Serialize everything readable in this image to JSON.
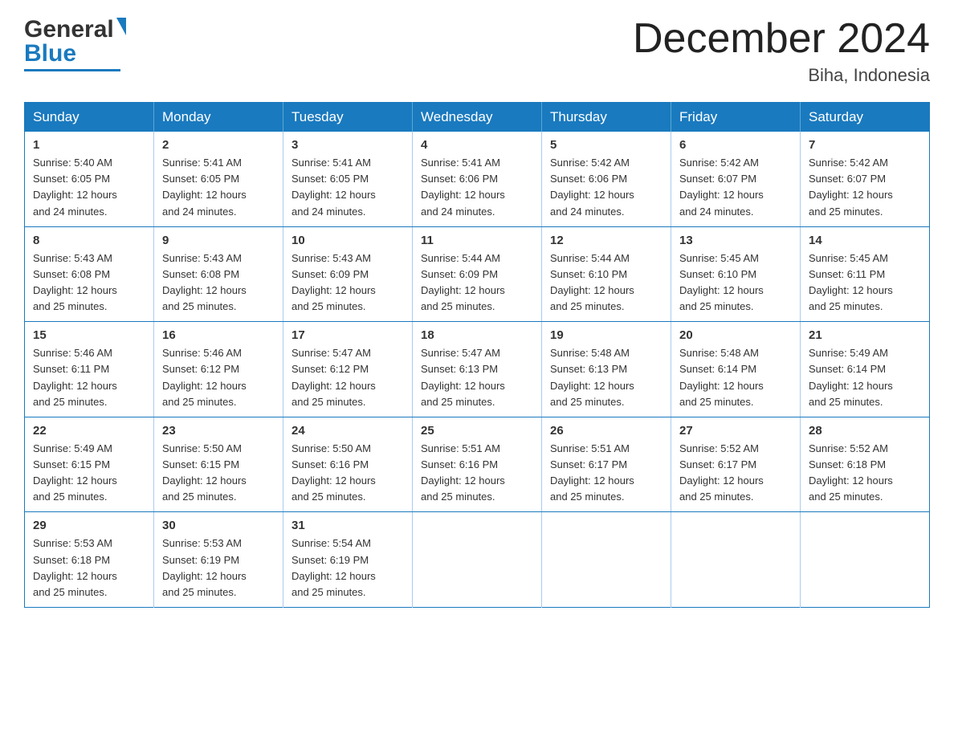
{
  "header": {
    "logo_general": "General",
    "logo_blue": "Blue",
    "month_title": "December 2024",
    "location": "Biha, Indonesia"
  },
  "days_of_week": [
    "Sunday",
    "Monday",
    "Tuesday",
    "Wednesday",
    "Thursday",
    "Friday",
    "Saturday"
  ],
  "weeks": [
    [
      {
        "day": "1",
        "sunrise": "5:40 AM",
        "sunset": "6:05 PM",
        "daylight": "12 hours and 24 minutes."
      },
      {
        "day": "2",
        "sunrise": "5:41 AM",
        "sunset": "6:05 PM",
        "daylight": "12 hours and 24 minutes."
      },
      {
        "day": "3",
        "sunrise": "5:41 AM",
        "sunset": "6:05 PM",
        "daylight": "12 hours and 24 minutes."
      },
      {
        "day": "4",
        "sunrise": "5:41 AM",
        "sunset": "6:06 PM",
        "daylight": "12 hours and 24 minutes."
      },
      {
        "day": "5",
        "sunrise": "5:42 AM",
        "sunset": "6:06 PM",
        "daylight": "12 hours and 24 minutes."
      },
      {
        "day": "6",
        "sunrise": "5:42 AM",
        "sunset": "6:07 PM",
        "daylight": "12 hours and 24 minutes."
      },
      {
        "day": "7",
        "sunrise": "5:42 AM",
        "sunset": "6:07 PM",
        "daylight": "12 hours and 25 minutes."
      }
    ],
    [
      {
        "day": "8",
        "sunrise": "5:43 AM",
        "sunset": "6:08 PM",
        "daylight": "12 hours and 25 minutes."
      },
      {
        "day": "9",
        "sunrise": "5:43 AM",
        "sunset": "6:08 PM",
        "daylight": "12 hours and 25 minutes."
      },
      {
        "day": "10",
        "sunrise": "5:43 AM",
        "sunset": "6:09 PM",
        "daylight": "12 hours and 25 minutes."
      },
      {
        "day": "11",
        "sunrise": "5:44 AM",
        "sunset": "6:09 PM",
        "daylight": "12 hours and 25 minutes."
      },
      {
        "day": "12",
        "sunrise": "5:44 AM",
        "sunset": "6:10 PM",
        "daylight": "12 hours and 25 minutes."
      },
      {
        "day": "13",
        "sunrise": "5:45 AM",
        "sunset": "6:10 PM",
        "daylight": "12 hours and 25 minutes."
      },
      {
        "day": "14",
        "sunrise": "5:45 AM",
        "sunset": "6:11 PM",
        "daylight": "12 hours and 25 minutes."
      }
    ],
    [
      {
        "day": "15",
        "sunrise": "5:46 AM",
        "sunset": "6:11 PM",
        "daylight": "12 hours and 25 minutes."
      },
      {
        "day": "16",
        "sunrise": "5:46 AM",
        "sunset": "6:12 PM",
        "daylight": "12 hours and 25 minutes."
      },
      {
        "day": "17",
        "sunrise": "5:47 AM",
        "sunset": "6:12 PM",
        "daylight": "12 hours and 25 minutes."
      },
      {
        "day": "18",
        "sunrise": "5:47 AM",
        "sunset": "6:13 PM",
        "daylight": "12 hours and 25 minutes."
      },
      {
        "day": "19",
        "sunrise": "5:48 AM",
        "sunset": "6:13 PM",
        "daylight": "12 hours and 25 minutes."
      },
      {
        "day": "20",
        "sunrise": "5:48 AM",
        "sunset": "6:14 PM",
        "daylight": "12 hours and 25 minutes."
      },
      {
        "day": "21",
        "sunrise": "5:49 AM",
        "sunset": "6:14 PM",
        "daylight": "12 hours and 25 minutes."
      }
    ],
    [
      {
        "day": "22",
        "sunrise": "5:49 AM",
        "sunset": "6:15 PM",
        "daylight": "12 hours and 25 minutes."
      },
      {
        "day": "23",
        "sunrise": "5:50 AM",
        "sunset": "6:15 PM",
        "daylight": "12 hours and 25 minutes."
      },
      {
        "day": "24",
        "sunrise": "5:50 AM",
        "sunset": "6:16 PM",
        "daylight": "12 hours and 25 minutes."
      },
      {
        "day": "25",
        "sunrise": "5:51 AM",
        "sunset": "6:16 PM",
        "daylight": "12 hours and 25 minutes."
      },
      {
        "day": "26",
        "sunrise": "5:51 AM",
        "sunset": "6:17 PM",
        "daylight": "12 hours and 25 minutes."
      },
      {
        "day": "27",
        "sunrise": "5:52 AM",
        "sunset": "6:17 PM",
        "daylight": "12 hours and 25 minutes."
      },
      {
        "day": "28",
        "sunrise": "5:52 AM",
        "sunset": "6:18 PM",
        "daylight": "12 hours and 25 minutes."
      }
    ],
    [
      {
        "day": "29",
        "sunrise": "5:53 AM",
        "sunset": "6:18 PM",
        "daylight": "12 hours and 25 minutes."
      },
      {
        "day": "30",
        "sunrise": "5:53 AM",
        "sunset": "6:19 PM",
        "daylight": "12 hours and 25 minutes."
      },
      {
        "day": "31",
        "sunrise": "5:54 AM",
        "sunset": "6:19 PM",
        "daylight": "12 hours and 25 minutes."
      },
      null,
      null,
      null,
      null
    ]
  ],
  "labels": {
    "sunrise": "Sunrise:",
    "sunset": "Sunset:",
    "daylight": "Daylight:"
  },
  "colors": {
    "header_bg": "#1a7abf",
    "border": "#1a7abf",
    "text_dark": "#222",
    "logo_blue": "#1a7abf"
  }
}
